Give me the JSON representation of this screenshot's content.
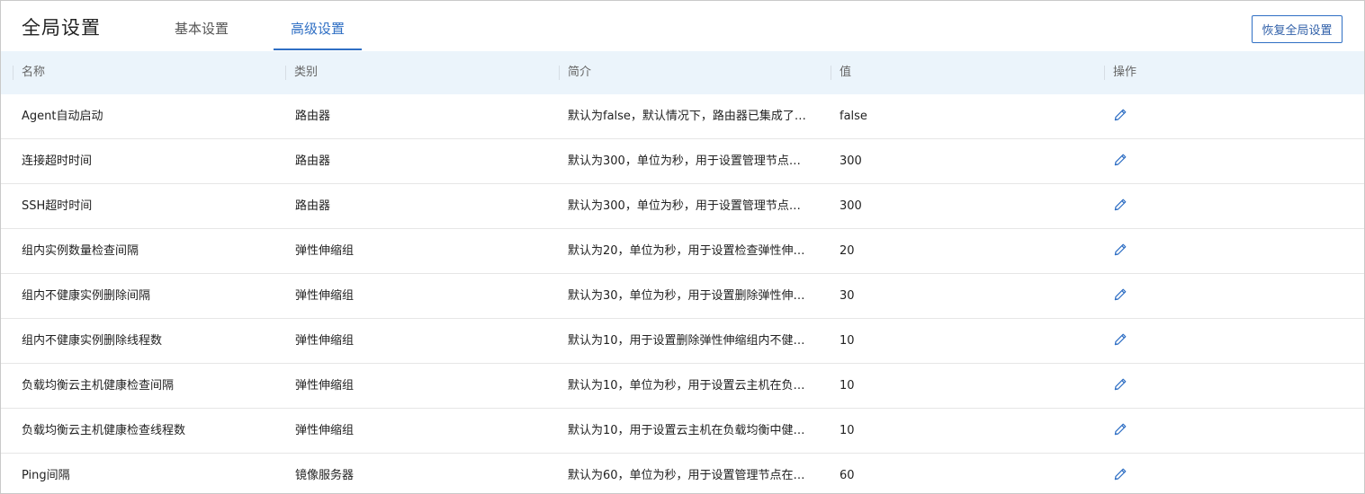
{
  "header": {
    "title": "全局设置",
    "tabs": [
      {
        "label": "基本设置",
        "active": false
      },
      {
        "label": "高级设置",
        "active": true
      }
    ],
    "restore_button": "恢复全局设置"
  },
  "table": {
    "columns": [
      "名称",
      "类别",
      "简介",
      "值",
      "操作"
    ],
    "rows": [
      {
        "name": "Agent自动启动",
        "category": "路由器",
        "desc": "默认为false，默认情况下，路由器已集成了…",
        "value": "false"
      },
      {
        "name": "连接超时时间",
        "category": "路由器",
        "desc": "默认为300，单位为秒，用于设置管理节点…",
        "value": "300"
      },
      {
        "name": "SSH超时时间",
        "category": "路由器",
        "desc": "默认为300，单位为秒，用于设置管理节点…",
        "value": "300"
      },
      {
        "name": "组内实例数量检查间隔",
        "category": "弹性伸缩组",
        "desc": "默认为20，单位为秒，用于设置检查弹性伸…",
        "value": "20"
      },
      {
        "name": "组内不健康实例删除间隔",
        "category": "弹性伸缩组",
        "desc": "默认为30，单位为秒，用于设置删除弹性伸…",
        "value": "30"
      },
      {
        "name": "组内不健康实例删除线程数",
        "category": "弹性伸缩组",
        "desc": "默认为10，用于设置删除弹性伸缩组内不健…",
        "value": "10"
      },
      {
        "name": "负载均衡云主机健康检查间隔",
        "category": "弹性伸缩组",
        "desc": "默认为10，单位为秒，用于设置云主机在负…",
        "value": "10"
      },
      {
        "name": "负载均衡云主机健康检查线程数",
        "category": "弹性伸缩组",
        "desc": "默认为10，用于设置云主机在负载均衡中健…",
        "value": "10"
      },
      {
        "name": "Ping间隔",
        "category": "镜像服务器",
        "desc": "默认为60，单位为秒，用于设置管理节点在…",
        "value": "60"
      }
    ],
    "edit_icon": "pencil-icon"
  },
  "colors": {
    "accent": "#2f6fc4",
    "header_bg": "#ebf4fb",
    "row_border": "#e6e6e6"
  }
}
